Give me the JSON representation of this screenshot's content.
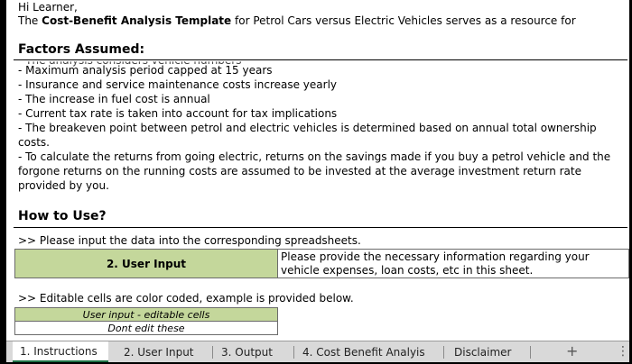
{
  "intro": {
    "greeting": "Hi Learner,",
    "sentence_prefix": "The ",
    "sentence_bold": "Cost-Benefit Analysis Template",
    "sentence_suffix": " for Petrol Cars versus Electric Vehicles serves as a resource for"
  },
  "factors": {
    "heading": "Factors Assumed:",
    "cut_line": "- The analysis considers vehicle numbers",
    "items": [
      "- Maximum analysis period capped at 15 years",
      "- Insurance and service maintenance costs increase yearly",
      "- The increase in fuel cost is annual",
      "- Current tax rate is taken into account for tax implications",
      "- The breakeven point between petrol and electric vehicles is determined based on annual total ownership",
      "costs.",
      "- To calculate the returns from going electric, returns on the savings made if you buy a petrol vehicle and the",
      "forgone returns on the running costs are assumed to be invested at the average investment return rate",
      "provided by you."
    ]
  },
  "how_to": {
    "heading": "How to Use?",
    "instruction": ">> Please input the data into the corresponding spreadsheets.",
    "user_input_label": "2. User Input",
    "user_input_desc_1": "Please provide the necessary information regarding your",
    "user_input_desc_2": "vehicle expenses, loan costs, etc in this sheet.",
    "color_note": ">> Editable cells are color coded, example is provided below.",
    "legend_editable": "User input - editable cells",
    "legend_locked": "Dont edit these"
  },
  "tabs": [
    {
      "label": "1. Instructions",
      "active": true
    },
    {
      "label": "2. User Input",
      "active": false
    },
    {
      "label": "3. Output",
      "active": false
    },
    {
      "label": "4. Cost Benefit Analyis",
      "active": false
    },
    {
      "label": "Disclaimer",
      "active": false
    }
  ],
  "tab_controls": {
    "add": "+",
    "more": "⋮"
  },
  "colors": {
    "editable_green": "#c4d79b",
    "active_tab_underline": "#1e7145"
  }
}
